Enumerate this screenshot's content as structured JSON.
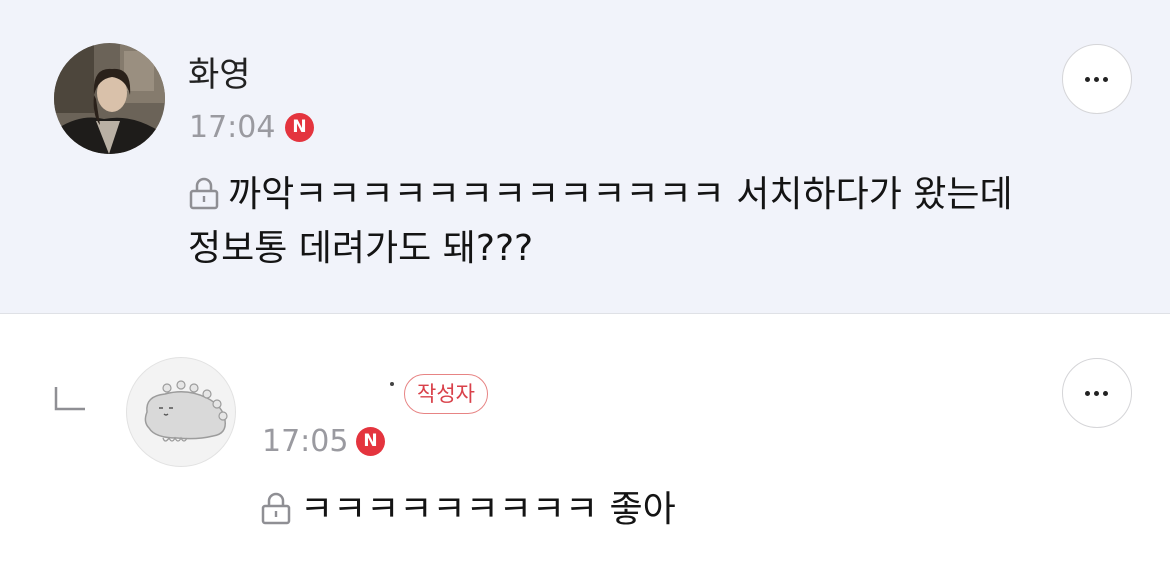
{
  "comments": [
    {
      "author": "화영",
      "time": "17:04",
      "new_badge": "N",
      "text_line1": "까악ㅋㅋㅋㅋㅋㅋㅋㅋㅋㅋㅋㅋㅋ 서치하다가 왔는데",
      "text_line2": "정보통 데려가도 돼???",
      "secret_icon": "lock-icon",
      "more_icon": "more-dots-icon",
      "avatar": "profile-photo"
    },
    {
      "author": "",
      "writer_badge": "작성자",
      "time": "17:05",
      "new_badge": "N",
      "text": "ㅋㅋㅋㅋㅋㅋㅋㅋㅋ 좋아",
      "secret_icon": "lock-icon",
      "more_icon": "more-dots-icon",
      "reply_icon": "reply-arrow-icon",
      "avatar": "default-character-avatar"
    }
  ],
  "colors": {
    "highlight_bg": "#f1f3fa",
    "new_badge": "#e4343e",
    "writer_badge": "#d9414a",
    "timestamp": "#9a9aa0"
  }
}
